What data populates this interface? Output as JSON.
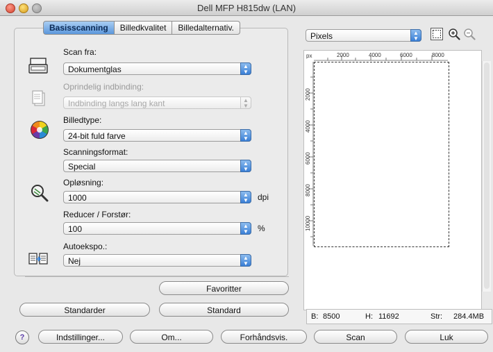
{
  "window": {
    "title": "Dell MFP H815dw (LAN)"
  },
  "tabs": [
    "Basisscanning",
    "Billedkvalitet",
    "Billedalternativ."
  ],
  "fields": {
    "scan_from": {
      "label": "Scan fra:",
      "value": "Dokumentglas"
    },
    "binding": {
      "label": "Oprindelig indbinding:",
      "value": "Indbinding langs lang kant"
    },
    "image_type": {
      "label": "Billedtype:",
      "value": "24-bit fuld farve"
    },
    "scan_format": {
      "label": "Scanningsformat:",
      "value": "Special"
    },
    "resolution": {
      "label": "Opløsning:",
      "value": "1000",
      "unit": "dpi"
    },
    "scale": {
      "label": "Reducer / Forstør:",
      "value": "100",
      "unit": "%"
    },
    "auto_exposure": {
      "label": "Autoekspo.:",
      "value": "Nej"
    }
  },
  "buttons": {
    "favorites": "Favoritter",
    "defaults": "Standarder",
    "standard": "Standard",
    "settings": "Indstillinger...",
    "about": "Om...",
    "preview": "Forhåndsvis.",
    "scan": "Scan",
    "close": "Luk",
    "help": "?"
  },
  "preview": {
    "units_select": "Pixels",
    "ruler_unit": "px",
    "ruler_top": [
      "2000",
      "4000",
      "6000",
      "8000"
    ],
    "ruler_left": [
      "2000",
      "4000",
      "6000",
      "8000",
      "10000"
    ],
    "width_label": "B:",
    "width_value": "8500",
    "height_label": "H:",
    "height_value": "11692",
    "size_label": "Str:",
    "size_value": "284.4MB"
  },
  "icons": [
    "flatbed-scanner-icon",
    "binding-icon",
    "color-wheel-icon",
    "resolution-magnifier-icon",
    "auto-exposure-icon",
    "select-frame-icon",
    "zoom-in-icon",
    "zoom-out-icon"
  ]
}
